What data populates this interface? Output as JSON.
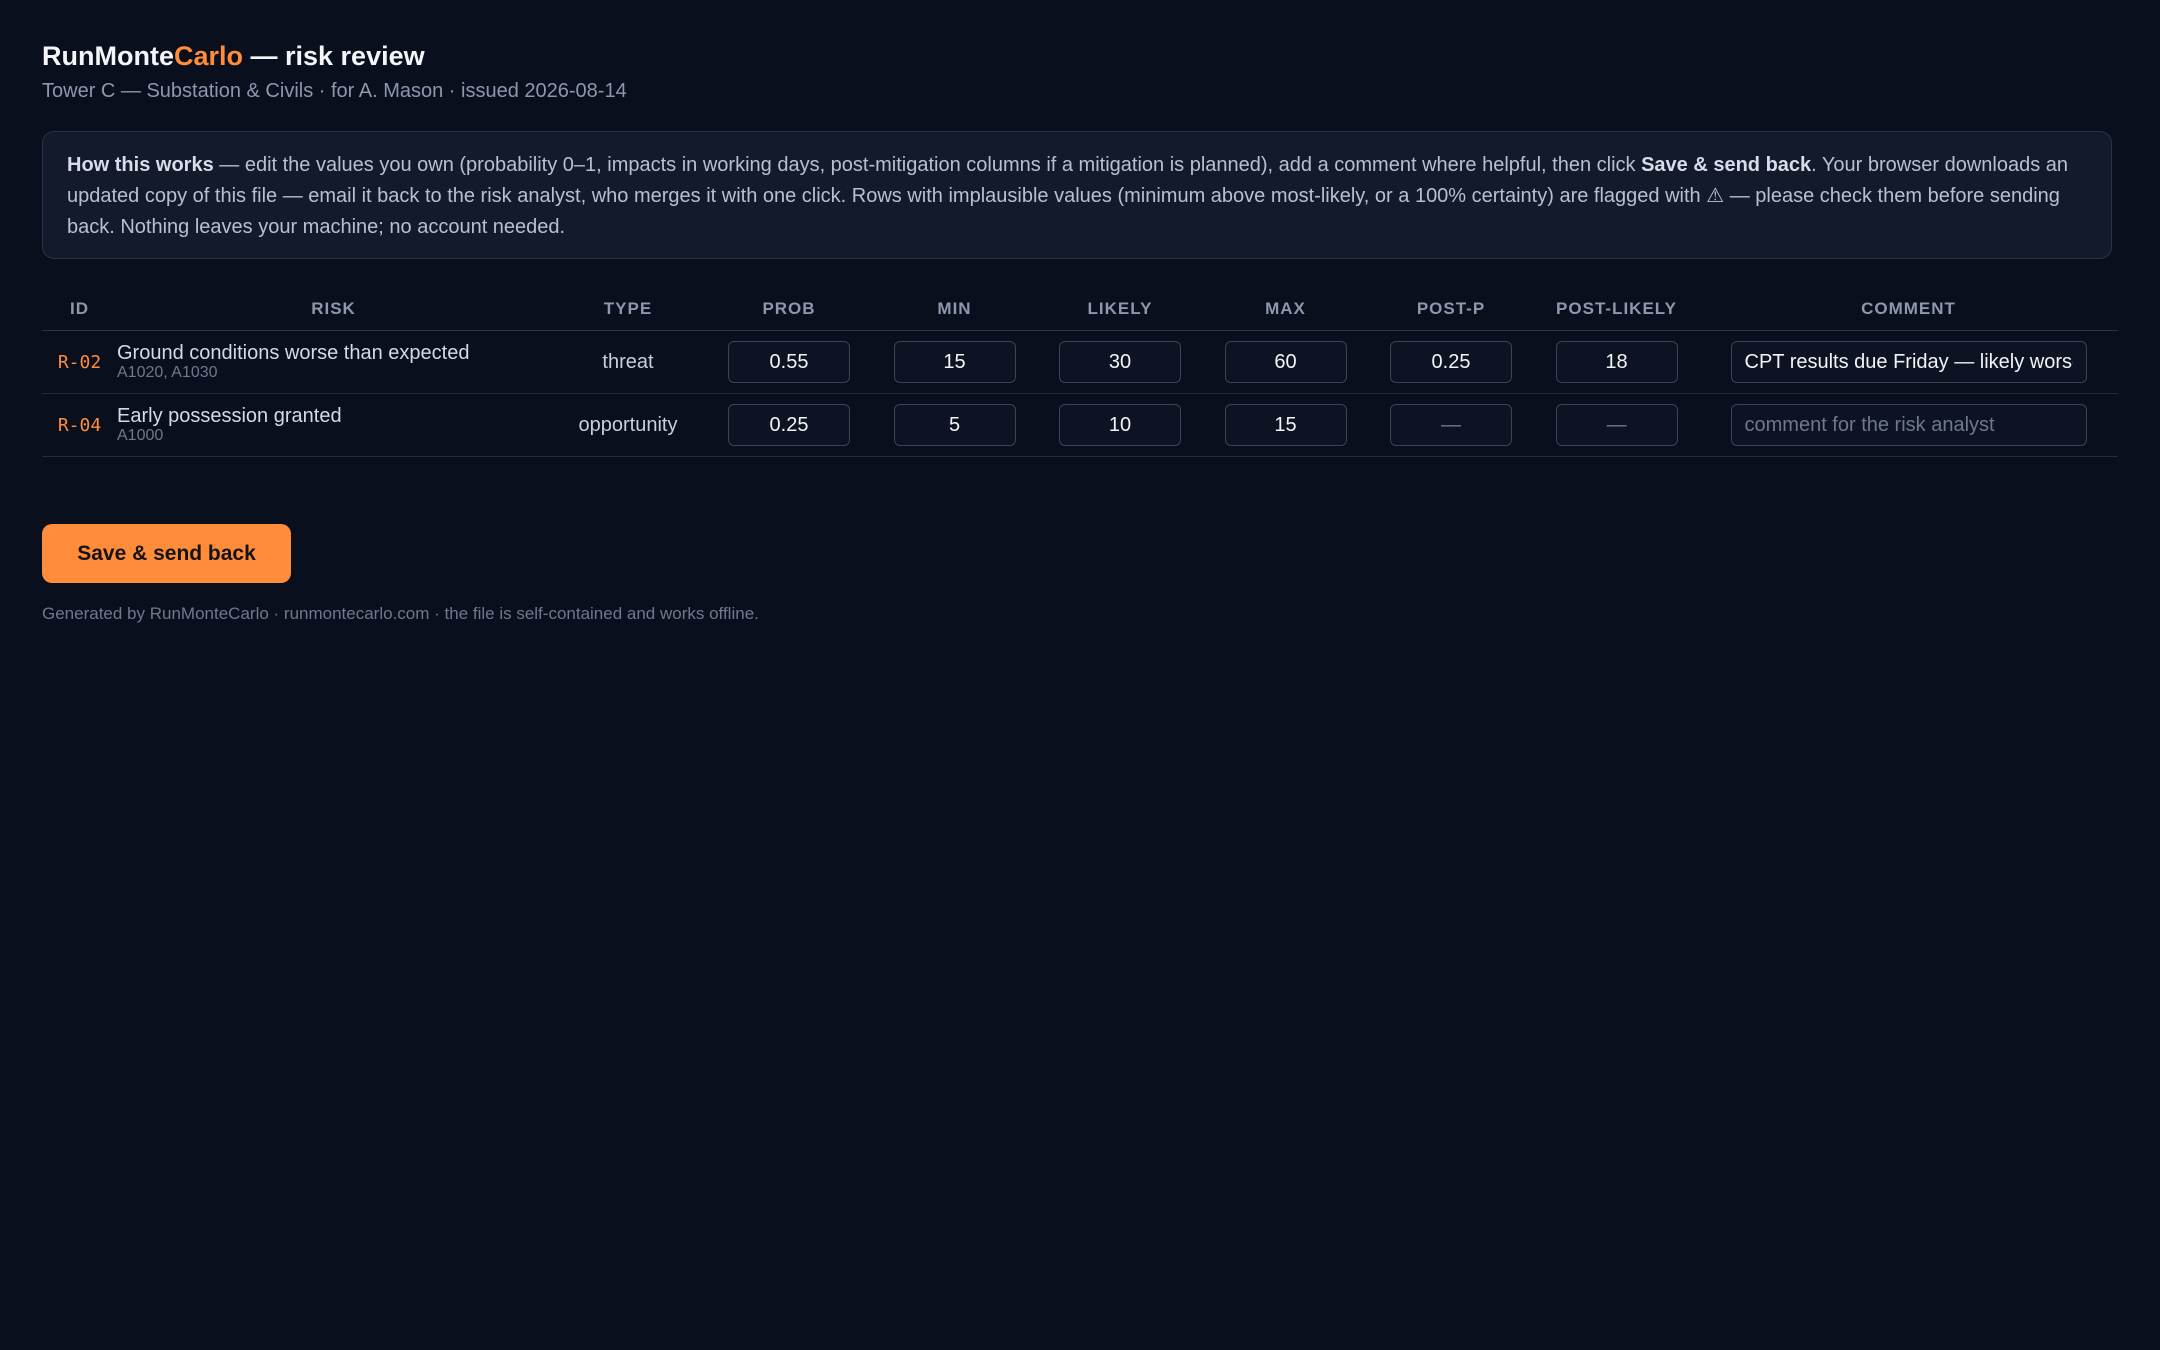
{
  "header": {
    "title_part1": "RunMonte",
    "title_part2": "Carlo",
    "title_part3": " — risk review",
    "subtitle": "Tower C — Substation & Civils · for A. Mason · issued 2026-08-14"
  },
  "info": {
    "lead": "How this works",
    "text1": " — edit the values you own (probability 0–1, impacts in working days, post-mitigation columns if a mitigation is planned), add a comment where helpful, then click ",
    "action": "Save & send back",
    "text2": ". Your browser downloads an updated copy of this file — email it back to the risk analyst, who merges it with one click. Rows with implausible values (minimum above most-likely, or a 100% certainty) are flagged with ⚠ — please check them before sending back. Nothing leaves your machine; no account needed."
  },
  "table": {
    "columns": [
      "ID",
      "RISK",
      "TYPE",
      "PROB",
      "MIN",
      "LIKELY",
      "MAX",
      "POST-P",
      "POST-LIKELY",
      "COMMENT"
    ],
    "rows": [
      {
        "id": "R-02",
        "title": "Ground conditions worse than expected",
        "activities": "A1020, A1030",
        "type": "threat",
        "prob": "0.55",
        "min": "15",
        "likely": "30",
        "max": "60",
        "post_p": "0.25",
        "post_p_placeholder": "",
        "post_likely": "18",
        "post_likely_placeholder": "",
        "comment": "CPT results due Friday — likely worse",
        "comment_placeholder": "comment for the risk analyst"
      },
      {
        "id": "R-04",
        "title": "Early possession granted",
        "activities": "A1000",
        "type": "opportunity",
        "prob": "0.25",
        "min": "5",
        "likely": "10",
        "max": "15",
        "post_p": "",
        "post_p_placeholder": "—",
        "post_likely": "",
        "post_likely_placeholder": "—",
        "comment": "",
        "comment_placeholder": "comment for the risk analyst"
      }
    ]
  },
  "save_button_label": "Save & send back",
  "footer": "Generated by RunMonteCarlo · runmontecarlo.com · the file is self-contained and works offline.",
  "colors": {
    "accent": "#ff8c3a",
    "background": "#0a0f1d"
  }
}
